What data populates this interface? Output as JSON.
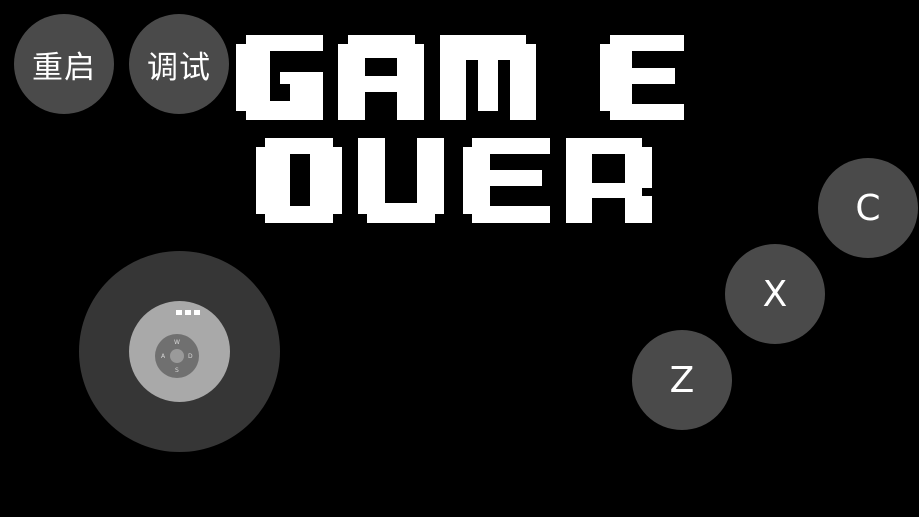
{
  "top_buttons": {
    "restart_label": "重启",
    "debug_label": "调试"
  },
  "game_over": {
    "text": "GAME OVER"
  },
  "joystick": {
    "dpad_up": "W",
    "dpad_left": "A",
    "dpad_right": "D",
    "dpad_down": "S"
  },
  "action_buttons": {
    "z_label": "Z",
    "x_label": "X",
    "c_label": "C"
  },
  "colors": {
    "background": "#000000",
    "button_fill": "#4a4a4a",
    "button_text": "#ffffff",
    "joystick_base": "#363636",
    "joystick_knob": "#a9a9a9",
    "title_text": "#ffffff"
  },
  "icons": {
    "joystick_drag_indicator": "three-dots-icon"
  }
}
